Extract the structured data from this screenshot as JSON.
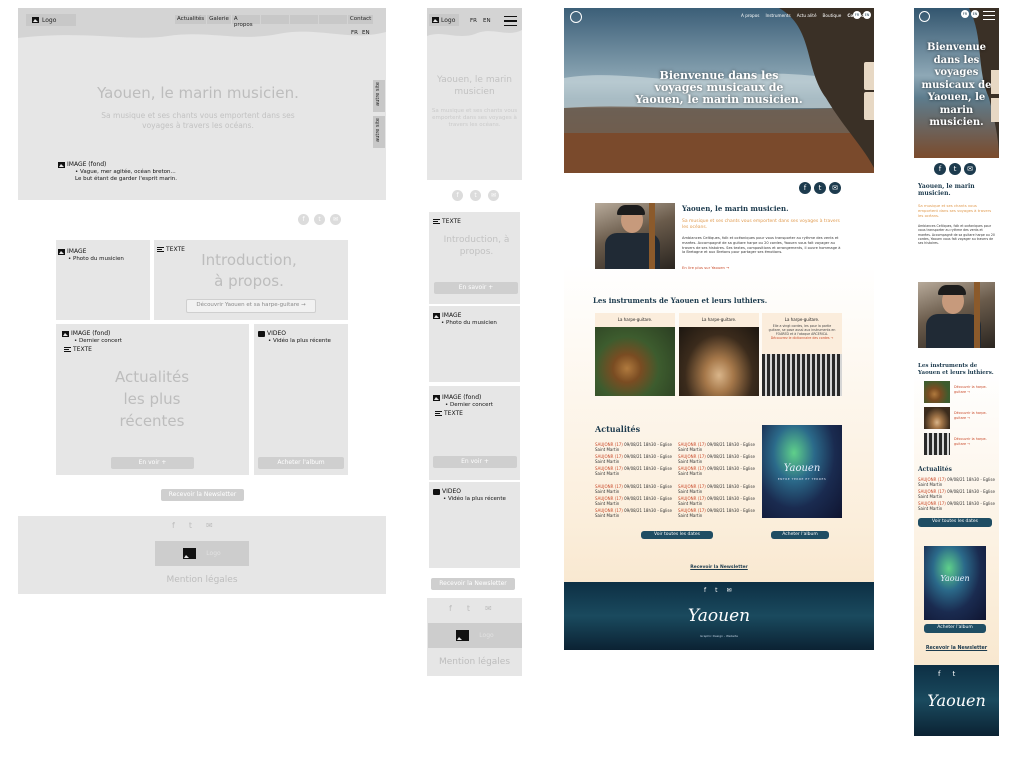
{
  "wire_desktop": {
    "logo_label": "Logo",
    "nav": [
      "Actualités",
      "Galerie",
      "A propos",
      "",
      "",
      "",
      "Contact"
    ],
    "lang": [
      "FR",
      "EN"
    ],
    "hero_title": "Yaouen, le marin musicien.",
    "hero_sub": "Sa musique et ses chants vous emportent dans ses voyages à travers les océans.",
    "side_tabs": [
      "autre site",
      "autre site"
    ],
    "hero_image_label": "IMAGE (fond)",
    "hero_image_bullet": "Vague, mer agitée, océan breton... Le but étant de garder l'esprit marin.",
    "social": [
      "f",
      "t",
      "✉"
    ],
    "photo_label": "IMAGE",
    "photo_bullet": "Photo du musicien",
    "intro_label": "TEXTE",
    "intro_title": "Introduction, à propos.",
    "intro_btn": "Découvrir Yaouen et sa harpe-guitare →",
    "concert_label": "IMAGE (fond)",
    "concert_bullet": "Dernier concert",
    "concert_text_label": "TEXTE",
    "news_title": "Actualités les plus récentes",
    "news_btn": "En voir +",
    "video_label": "VIDEO",
    "video_bullet": "Vidéo la plus récente",
    "album_btn": "Acheter l'album",
    "newsletter_btn": "Recevoir la Newsletter",
    "footer_social": [
      "f",
      "t",
      "✉"
    ],
    "footer_logo": "Logo",
    "legal": "Mention légales"
  },
  "wire_mobile": {
    "logo_label": "Logo",
    "lang": [
      "FR",
      "EN"
    ],
    "hero_title": "Yaouen, le marin musicien",
    "hero_sub": "Sa musique et ses chants vous emportent dans ses voyages à travers les océans.",
    "social": [
      "f",
      "t",
      "✉"
    ],
    "intro_label": "TEXTE",
    "intro_title": "Introduction, à propos.",
    "intro_btn": "En savoir +",
    "photo_label": "IMAGE",
    "photo_bullet": "Photo du musicien",
    "concert_label": "IMAGE (fond)",
    "concert_bullet": "Dernier concert",
    "concert_text_label": "TEXTE",
    "news_btn": "En voir +",
    "video_label": "VIDEO",
    "video_bullet": "Vidéo la plus récente",
    "newsletter_btn": "Recevoir la Newsletter",
    "footer_social": [
      "f",
      "t",
      "✉"
    ],
    "footer_logo": "Logo",
    "legal": "Mention légales"
  },
  "mock_desktop": {
    "nav": [
      "A propos",
      "Instruments",
      "Actu alité",
      "Boutique",
      "Contact"
    ],
    "lang": [
      "FR",
      "EN"
    ],
    "hero_title": "Bienvenue dans les voyages musicaux de Yaouen, le marin musicien.",
    "social": [
      "f",
      "t",
      "✉"
    ],
    "intro_title": "Yaouen, le marin musicien.",
    "intro_sub": "Sa musique et ses chants vous emportent dans ses voyages à travers les océans.",
    "intro_body": "Ambiances Celtiques, folk et océaniques pour vous transporter au rythme des vents et marées. Accompagné de sa guitare harpe ou 20 cordes, Yaouen vous fait voyager au travers de ses histoires. Ses textes, compositions et arrangements, il ouvre hommage à la Bretagne et aux Bretons pour partager ses émotions.",
    "intro_link": "En lire plus sur Yaouen →",
    "instruments_title": "Les instruments de Yaouen et leurs luthiers.",
    "instruments": [
      {
        "name": "La harpe-guitare."
      },
      {
        "name": "La harpe-guitare."
      },
      {
        "name": "La harpe-guitare.",
        "desc": "Elle a vingt cordes, les pour la partie guitare, se pose aussi aux instruments en FOARED et à l'ataque ARCERICA.",
        "link": "Découvrez le dictionnaire des cordes →"
      }
    ],
    "news_title": "Actualités",
    "news_items": [
      {
        "place": "SAUJONR (17)",
        "date": "09/08/21 18h30",
        "venue": "Eglise Saint Martin"
      },
      {
        "place": "SAUJONR (17)",
        "date": "09/08/21 18h30",
        "venue": "Eglise Saint Martin"
      },
      {
        "place": "SAUJONR (17)",
        "date": "09/08/21 18h30",
        "venue": "Eglise Saint Martin"
      },
      {
        "place": "SAUJONR (17)",
        "date": "09/08/21 18h30",
        "venue": "Eglise Saint Martin"
      },
      {
        "place": "SAUJONR (17)",
        "date": "09/08/21 18h30",
        "venue": "Eglise Saint Martin"
      },
      {
        "place": "SAUJONR (17)",
        "date": "09/08/21 18h30",
        "venue": "Eglise Saint Martin"
      }
    ],
    "album_title": "Yaouen",
    "album_sub": "ENTRE TERRE ET TERRES",
    "dates_btn": "Voir toutes les dates",
    "album_btn": "Acheter l'album",
    "newsletter": "Recevoir la Newsletter",
    "footer_social": [
      "f",
      "t",
      "✉"
    ],
    "footer_logo": "Yaouen",
    "footer_text": "Graphic Design - Website"
  },
  "mock_mobile": {
    "lang": [
      "FR",
      "EN"
    ],
    "hero_title": "Bienvenue dans les voyages musicaux de Yaouen, le marin musicien.",
    "social": [
      "f",
      "t",
      "✉"
    ],
    "intro_title": "Yaouen, le marin musicien.",
    "intro_sub": "Sa musique et ses chants vous emportent dans ses voyages à travers les océans.",
    "intro_body": "Ambiances Celtiques, folk et océaniques pour vous transporter au rythme des vents et marées. Accompagné de sa guitare harpe ou 20 cordes, Yaouen vous fait voyager au travers de ses histoires.",
    "instruments_title": "Les instruments de Yaouen et leurs luthiers.",
    "instrument_links": [
      "Découvrir la harpe-guitare →",
      "Découvrir la harpe-guitare →",
      "Découvrir la harpe-guitare →"
    ],
    "news_title": "Actualités",
    "news_items": [
      {
        "place": "SAUJONR (17)",
        "date": "09/08/21 18h30 -",
        "venue": "Eglise Saint Martin"
      },
      {
        "place": "SAUJONR (17)",
        "date": "09/08/21 18h30 -",
        "venue": "Eglise Saint Martin"
      },
      {
        "place": "SAUJONR (17)",
        "date": "09/08/21 18h30 -",
        "venue": "Eglise Saint Martin"
      }
    ],
    "dates_btn": "Voir toutes les dates",
    "album_title": "Yaouen",
    "album_btn": "Acheter l'album",
    "newsletter": "Recevoir la Newsletter",
    "footer_social": [
      "f",
      "t"
    ],
    "footer_logo": "Yaouen"
  }
}
